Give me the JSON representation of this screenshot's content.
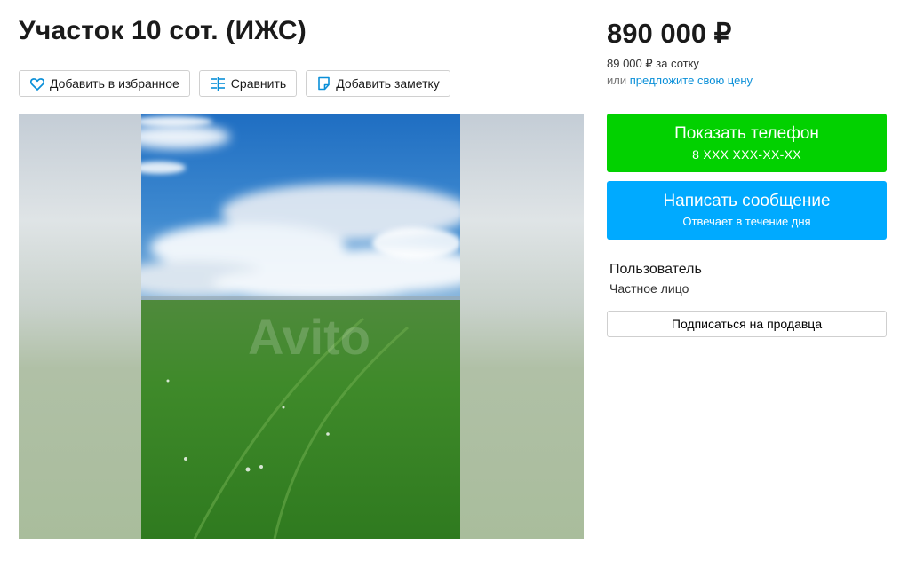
{
  "listing": {
    "title": "Участок 10 сот. (ИЖС)",
    "price": "890 000 ₽",
    "price_per_unit": "89 000 ₽ за сотку",
    "offer_prefix": "или",
    "offer_link": "предложите свою цену"
  },
  "actions": {
    "favorite_label": "Добавить в избранное",
    "compare_label": "Сравнить",
    "note_label": "Добавить заметку"
  },
  "contact": {
    "phone_label": "Показать телефон",
    "phone_masked": "8 XXX XXX-XX-XX",
    "message_label": "Написать сообщение",
    "message_sub": "Отвечает в течение дня"
  },
  "seller": {
    "name": "Пользователь",
    "type": "Частное лицо",
    "subscribe_label": "Подписаться на продавца"
  },
  "gallery": {
    "watermark": "Avito"
  },
  "colors": {
    "phone_button": "#02d100",
    "message_button": "#00aaff",
    "link": "#0a8fd8",
    "icon_accent": "#0a8fd8"
  },
  "icons": [
    "heart-icon",
    "compare-icon",
    "note-icon"
  ]
}
